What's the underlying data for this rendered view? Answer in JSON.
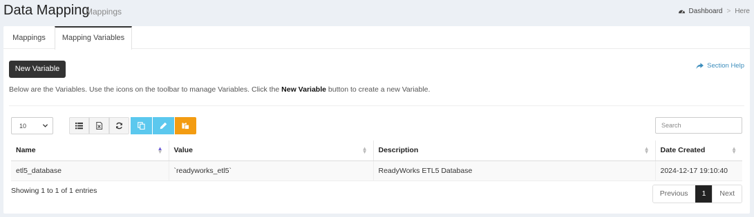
{
  "header": {
    "title": "Data Mapping",
    "subtitle": "Mappings",
    "breadcrumb": {
      "dashboard": "Dashboard",
      "separator": ">",
      "current": "Here"
    }
  },
  "tabs": [
    {
      "label": "Mappings"
    },
    {
      "label": "Mapping Variables"
    }
  ],
  "toolbar": {
    "new_label": "New Variable",
    "help_label": "Section Help"
  },
  "intro": {
    "before": "Below are the Variables. Use the icons on the toolbar to manage Variables. Click the ",
    "strong": "New Variable",
    "after": " button to create a new Variable."
  },
  "table_controls": {
    "page_length": "10",
    "search_placeholder": "Search",
    "icons": [
      "list-icon",
      "excel-icon",
      "refresh-icon",
      "copy-icon",
      "pencil-icon",
      "paste-icon"
    ]
  },
  "table": {
    "columns": [
      "Name",
      "Value",
      "Description",
      "Date Created"
    ],
    "rows": [
      [
        "etl5_database",
        "`readyworks_etl5`",
        "ReadyWorks ETL5 Database",
        "2024-12-17 19:10:40"
      ]
    ]
  },
  "footer": {
    "info": "Showing 1 to 1 of 1 entries",
    "prev": "Previous",
    "page": "1",
    "next": "Next"
  },
  "colors": {
    "accent": "#3c8dbc",
    "info_button": "#5bc8ee",
    "warning_button": "#f39c12",
    "dark": "#333333"
  }
}
